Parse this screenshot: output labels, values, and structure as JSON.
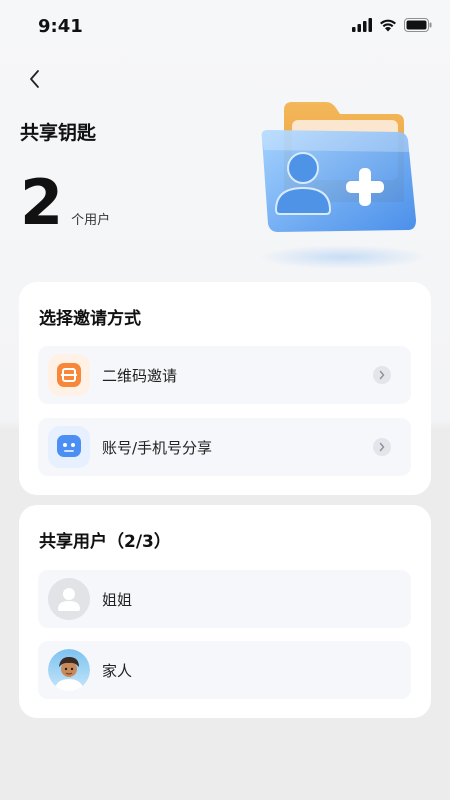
{
  "status_bar": {
    "time": "9:41"
  },
  "header": {
    "title": "共享钥匙"
  },
  "summary": {
    "count": "2",
    "unit": "个用户"
  },
  "invite": {
    "title": "选择邀请方式",
    "options": [
      {
        "label": "二维码邀请",
        "icon": "qr-code-icon"
      },
      {
        "label": "账号/手机号分享",
        "icon": "account-share-icon"
      }
    ]
  },
  "shared_users": {
    "title": "共享用户（2/3）",
    "users": [
      {
        "name": "姐姐",
        "avatar": "default-avatar"
      },
      {
        "name": "家人",
        "avatar": "photo-avatar"
      }
    ]
  },
  "colors": {
    "background": "#f3f4f6",
    "card": "#ffffff",
    "row": "#f6f7fb",
    "accent_blue": "#3f8ef7",
    "accent_orange": "#f7883a"
  }
}
